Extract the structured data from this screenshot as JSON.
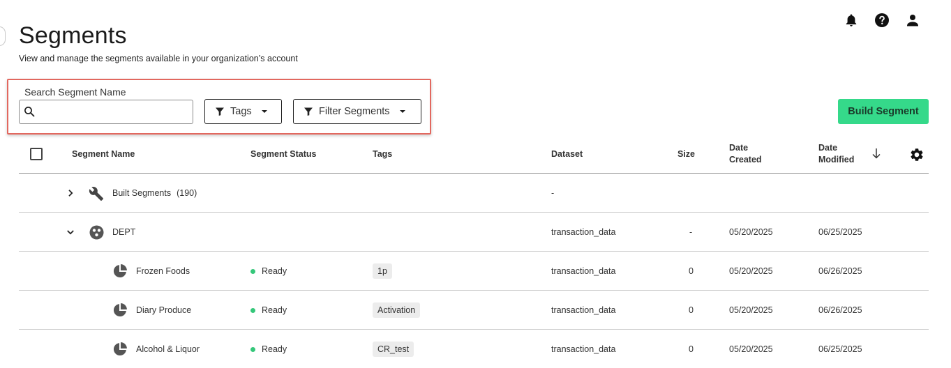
{
  "header": {
    "title": "Segments",
    "subtitle": "View and manage the segments available in your organization’s account",
    "icons": [
      "bell-icon",
      "help-icon",
      "user-icon"
    ]
  },
  "filters": {
    "search_label": "Search Segment Name",
    "search_value": "",
    "tags_label": "Tags",
    "filter_label": "Filter Segments"
  },
  "build_button": "Build Segment",
  "colors": {
    "accent_green": "#35d98a",
    "status_ready": "#35c77a",
    "highlight_border": "#e2685f"
  },
  "table": {
    "columns": {
      "name": "Segment Name",
      "status": "Segment Status",
      "tags": "Tags",
      "dataset": "Dataset",
      "size": "Size",
      "created_1": "Date",
      "created_2": "Created",
      "modified_1": "Date",
      "modified_2": "Modified"
    },
    "rows": [
      {
        "kind": "group",
        "expanded": false,
        "icon": "wrench-icon",
        "name": "Built Segments",
        "count": "(190)",
        "status": "",
        "tag": "",
        "dataset": "-",
        "size": "",
        "created": "",
        "modified": ""
      },
      {
        "kind": "group",
        "expanded": true,
        "icon": "dept-icon",
        "name": "DEPT",
        "count": "",
        "status": "",
        "tag": "",
        "dataset": "transaction_data",
        "size": "-",
        "created": "05/20/2025",
        "modified": "06/25/2025"
      },
      {
        "kind": "item",
        "icon": "pie-chart-icon",
        "name": "Frozen Foods",
        "status": "Ready",
        "tag": "1p",
        "dataset": "transaction_data",
        "size": "0",
        "created": "05/20/2025",
        "modified": "06/26/2025"
      },
      {
        "kind": "item",
        "icon": "pie-chart-icon",
        "name": "Diary Produce",
        "status": "Ready",
        "tag": "Activation",
        "dataset": "transaction_data",
        "size": "0",
        "created": "05/20/2025",
        "modified": "06/26/2025"
      },
      {
        "kind": "item",
        "icon": "pie-chart-icon",
        "name": "Alcohol & Liquor",
        "status": "Ready",
        "tag": "CR_test",
        "dataset": "transaction_data",
        "size": "0",
        "created": "05/20/2025",
        "modified": "06/25/2025"
      }
    ]
  }
}
